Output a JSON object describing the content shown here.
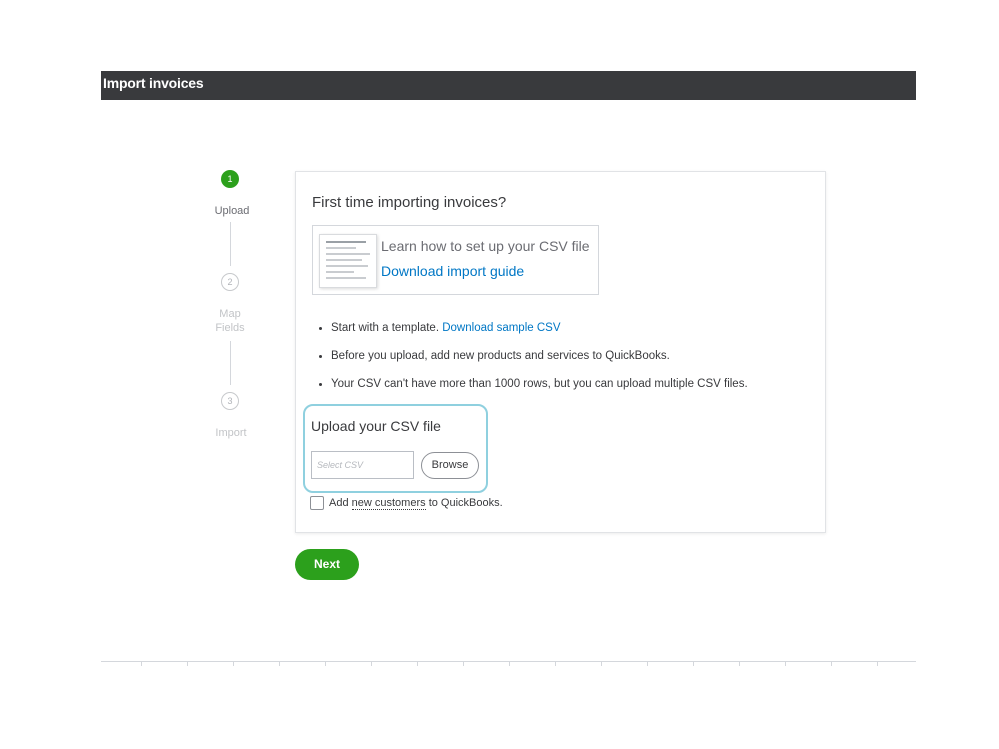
{
  "header": {
    "title": "Import invoices",
    "bg_color": "#393a3d"
  },
  "stepper": {
    "steps": [
      {
        "number": "1",
        "label": "Upload",
        "active": true
      },
      {
        "number": "2",
        "label_line1": "Map",
        "label_line2": "Fields",
        "active": false
      },
      {
        "number": "3",
        "label": "Import",
        "active": false
      }
    ],
    "active_color": "#2ca01c"
  },
  "card": {
    "title": "First time importing invoices?",
    "guide": {
      "text": "Learn how to set up your CSV file",
      "link": "Download import guide"
    },
    "bullets": {
      "item1_prefix": "Start with a template.",
      "item1_link": "Download sample CSV",
      "item2": "Before you upload, add new products and services to QuickBooks.",
      "item3": "Your CSV can't have more than 1000 rows, but you can upload multiple CSV files."
    },
    "upload": {
      "title": "Upload your CSV file",
      "placeholder": "Select CSV",
      "browse_label": "Browse"
    },
    "checkbox": {
      "prefix": "Add",
      "underlined": "new customers",
      "suffix": "to QuickBooks.",
      "checked": false
    }
  },
  "footer": {
    "next_label": "Next"
  },
  "colors": {
    "link": "#0077c5",
    "highlight": "#8fd0df",
    "primary": "#2ca01c"
  }
}
